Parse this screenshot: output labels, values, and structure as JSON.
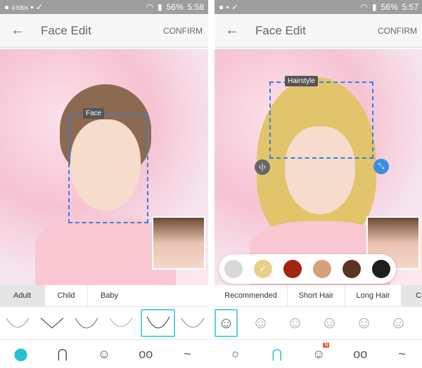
{
  "screens": [
    {
      "status": {
        "speed": "0 KB/s",
        "battery": "56%",
        "time": "5:58"
      },
      "header": {
        "title": "Face Edit",
        "confirm": "CONFIRM"
      },
      "edit_label": "Face",
      "tabs": [
        {
          "label": "Adult",
          "selected": true
        },
        {
          "label": "Child"
        },
        {
          "label": "Baby"
        }
      ]
    },
    {
      "status": {
        "battery": "56%",
        "time": "5:57"
      },
      "header": {
        "title": "Face Edit",
        "confirm": "CONFIRM"
      },
      "edit_label": "Hairstyle",
      "hair_colors": [
        "#d9d9d9",
        "#e8cf8a",
        "#a32410",
        "#d5a07c",
        "#5a3423",
        "#1e1e1e"
      ],
      "selected_color_index": 1,
      "tabs": [
        {
          "label": "Recommended"
        },
        {
          "label": "Short Hair"
        },
        {
          "label": "Long Hair"
        },
        {
          "label": "C",
          "selected": true
        }
      ],
      "nav_badge": "N"
    }
  ],
  "accent": "#2bbfd6"
}
